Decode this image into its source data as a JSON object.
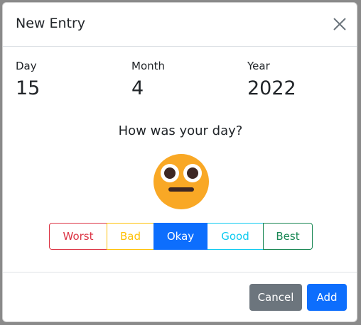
{
  "modal": {
    "title": "New Entry"
  },
  "date": {
    "day_label": "Day",
    "day_value": "15",
    "month_label": "Month",
    "month_value": "4",
    "year_label": "Year",
    "year_value": "2022"
  },
  "question": "How was your day?",
  "emoji": {
    "icon": "neutral-face-icon",
    "color": "#f9a825"
  },
  "mood_options": [
    {
      "label": "Worst",
      "color": "#dc3545",
      "selected": false
    },
    {
      "label": "Bad",
      "color": "#ffc107",
      "selected": false
    },
    {
      "label": "Okay",
      "color": "#0d6efd",
      "selected": true
    },
    {
      "label": "Good",
      "color": "#0dcaf0",
      "selected": false
    },
    {
      "label": "Best",
      "color": "#198754",
      "selected": false
    }
  ],
  "footer": {
    "cancel_label": "Cancel",
    "add_label": "Add"
  },
  "colors": {
    "primary": "#0d6efd",
    "secondary": "#6c757d"
  }
}
